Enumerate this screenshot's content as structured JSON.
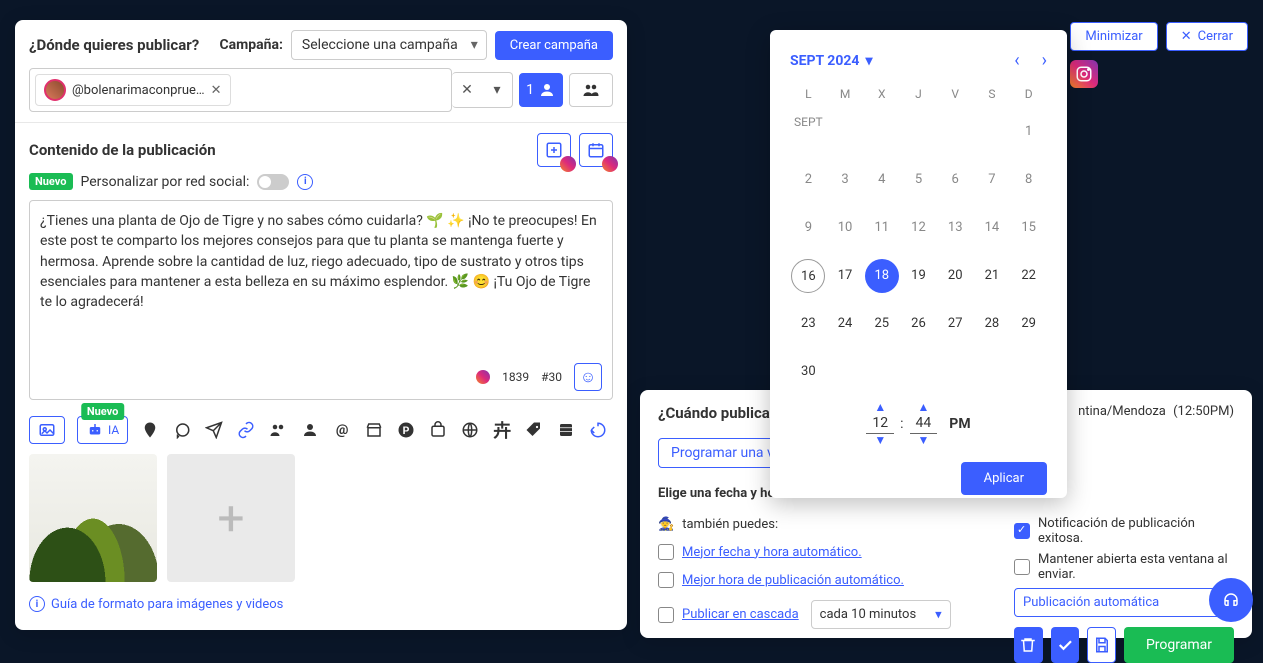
{
  "header": {
    "minimize": "Minimizar",
    "close": "Cerrar"
  },
  "publish": {
    "where_heading": "¿Dónde quieres publicar?",
    "campaign_label": "Campaña:",
    "campaign_placeholder": "Seleccione una campaña",
    "create_campaign": "Crear campaña",
    "account_handle": "@bolenarimaconprue…",
    "account_count": "1"
  },
  "content": {
    "heading": "Contenido de la publicación",
    "new_badge": "Nuevo",
    "personalize_label": "Personalizar por red social:",
    "body": "¿Tienes una planta de Ojo de Tigre y no sabes cómo cuidarla? 🌱 ✨ ¡No te preocupes! En este post te comparto los mejores consejos para que tu planta se mantenga fuerte y hermosa. Aprende sobre la cantidad de luz, riego adecuado, tipo de sustrato y otros tips esenciales para mantener a esta belleza en su máximo esplendor. 🌿 😊 ¡Tu Ojo de Tigre te lo agradecerá!",
    "char_count": "1839",
    "hash_count": "#30",
    "ia_label": "IA",
    "format_guide": "Guía de formato para imágenes y videos"
  },
  "schedule": {
    "heading": "¿Cuándo publicar?",
    "once_btn": "Programar una vez",
    "pick_label": "Elige una fecha y hora:",
    "also_label": "también puedes:",
    "best_datetime": "Mejor fecha y hora automático.",
    "best_time": "Mejor hora de publicación automático.",
    "cascade": "Publicar en cascada",
    "cascade_interval": "cada 10 minutos",
    "tz_text": "ntina/Mendoza",
    "tz_time": "(12:50PM)",
    "notify_success": "Notificación de publicación exitosa.",
    "keep_open": "Mantener abierta esta ventana al enviar.",
    "auto_publish": "Publicación automática",
    "program_btn": "Programar"
  },
  "calendar": {
    "title": "SEPT 2024",
    "month_short": "SEPT",
    "dow": [
      "L",
      "M",
      "X",
      "J",
      "V",
      "S",
      "D"
    ],
    "days_prev": [
      1,
      2,
      3,
      4,
      5,
      6,
      7,
      8,
      9,
      10,
      11,
      12,
      13,
      14,
      15
    ],
    "days_cur": [
      16,
      17,
      18,
      19,
      20,
      21,
      22,
      23,
      24,
      25,
      26,
      27,
      28,
      29,
      30
    ],
    "today": 16,
    "selected": 18,
    "hour": "12",
    "minute": "44",
    "ampm": "PM",
    "apply": "Aplicar"
  }
}
